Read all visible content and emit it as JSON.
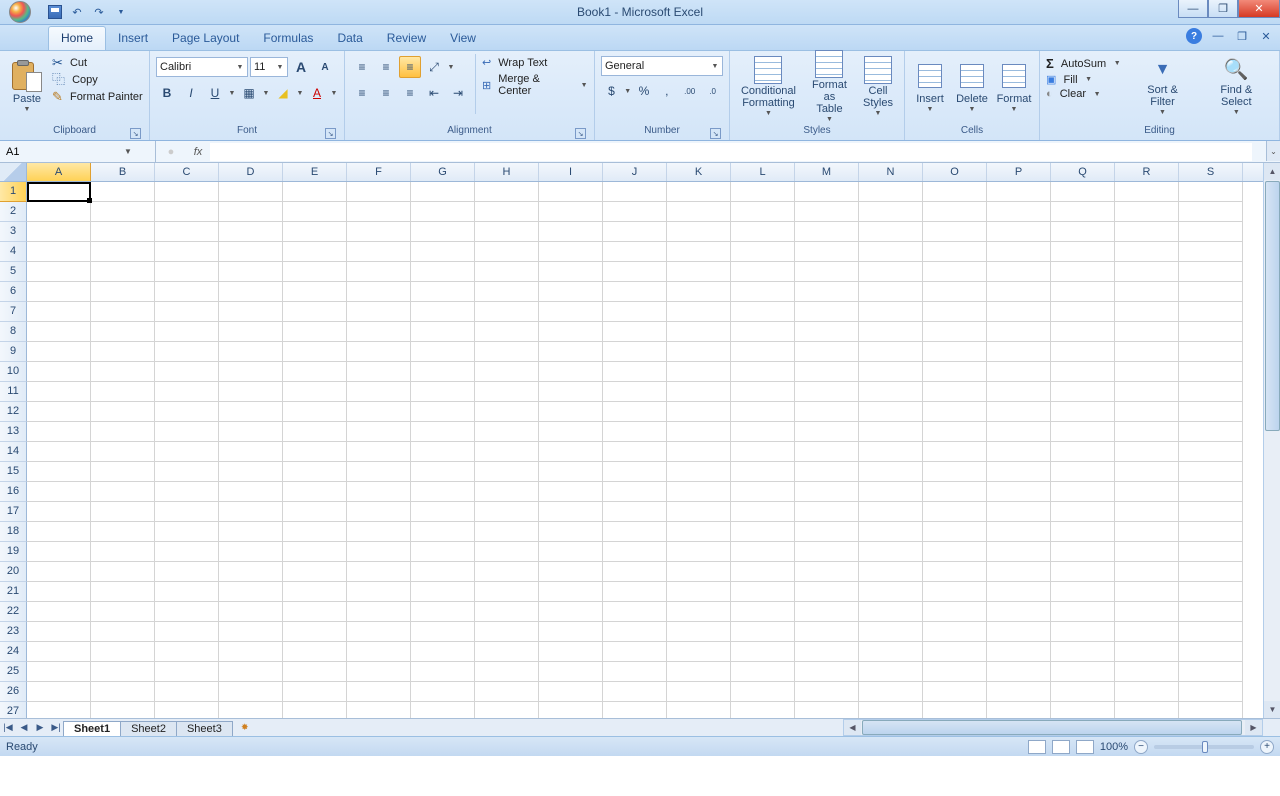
{
  "title": "Book1 - Microsoft Excel",
  "qat": {
    "save": "Save",
    "undo": "↶",
    "redo": "↷"
  },
  "tabs": [
    "Home",
    "Insert",
    "Page Layout",
    "Formulas",
    "Data",
    "Review",
    "View"
  ],
  "active_tab": 0,
  "ribbon": {
    "clipboard": {
      "label": "Clipboard",
      "paste": "Paste",
      "cut": "Cut",
      "copy": "Copy",
      "painter": "Format Painter"
    },
    "font": {
      "label": "Font",
      "name": "Calibri",
      "size": "11",
      "growA": "A",
      "shrinkA": "A",
      "bold": "B",
      "italic": "I",
      "underline": "U"
    },
    "alignment": {
      "label": "Alignment",
      "wrap": "Wrap Text",
      "merge": "Merge & Center"
    },
    "number": {
      "label": "Number",
      "format": "General",
      "percent": "%",
      "comma": ",",
      "inc": "←.0",
      "dec": ".00→"
    },
    "styles": {
      "label": "Styles",
      "cond": "Conditional Formatting",
      "table": "Format as Table",
      "cell": "Cell Styles"
    },
    "cells": {
      "label": "Cells",
      "insert": "Insert",
      "delete": "Delete",
      "format": "Format"
    },
    "editing": {
      "label": "Editing",
      "sum": "AutoSum",
      "fill": "Fill",
      "clear": "Clear",
      "sort": "Sort & Filter",
      "find": "Find & Select"
    }
  },
  "namebox": "A1",
  "formula": "",
  "columns": [
    "A",
    "B",
    "C",
    "D",
    "E",
    "F",
    "G",
    "H",
    "I",
    "J",
    "K",
    "L",
    "M",
    "N",
    "O",
    "P",
    "Q",
    "R",
    "S"
  ],
  "rows": 27,
  "selected_col": 0,
  "selected_row": 1,
  "sheets": [
    "Sheet1",
    "Sheet2",
    "Sheet3"
  ],
  "active_sheet": 0,
  "status": "Ready",
  "zoom": "100%"
}
